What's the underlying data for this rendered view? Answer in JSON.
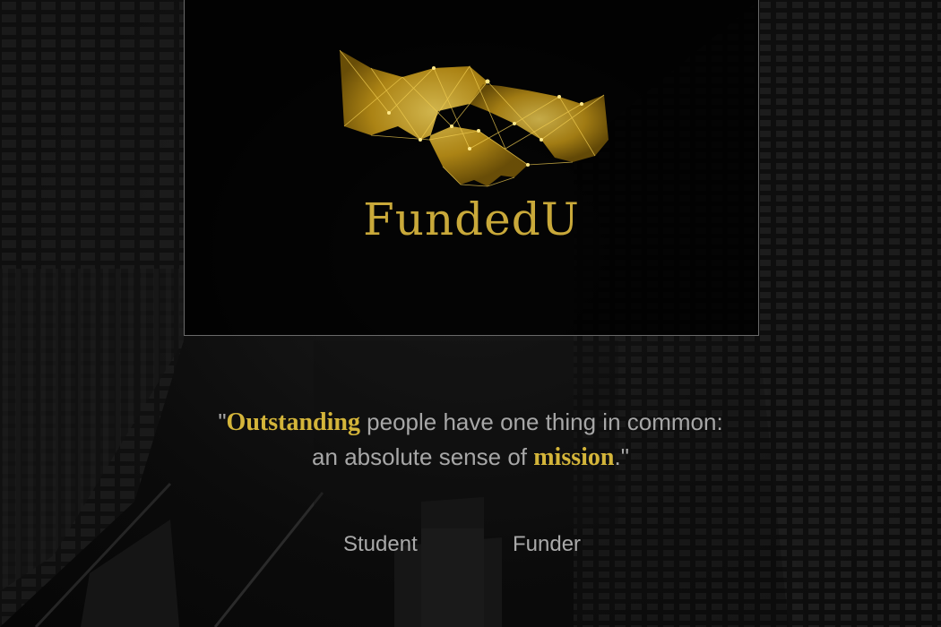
{
  "brand": {
    "name": "FundedU",
    "color": "#c9a93a"
  },
  "logo": {
    "icon": "handshake-icon"
  },
  "quote": {
    "open_quote": "\"",
    "highlight_1": "Outstanding",
    "text_1": " people have one thing in common:",
    "text_2": "an absolute sense of ",
    "highlight_2": "mission",
    "close": ".\"",
    "highlight_color": "#d4b53a"
  },
  "nav": {
    "student_label": "Student",
    "funder_label": "Funder"
  }
}
